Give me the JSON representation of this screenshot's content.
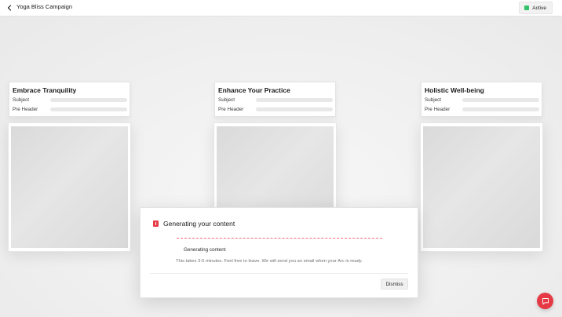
{
  "header": {
    "title": "Yoga Bliss Campaign",
    "status_label": "Active"
  },
  "cards": [
    {
      "title": "Embrace Tranquility",
      "subject_label": "Subject",
      "preheader_label": "Pre Header"
    },
    {
      "title": "Enhance Your Practice",
      "subject_label": "Subject",
      "preheader_label": "Pre Header"
    },
    {
      "title": "Holistic Well-being",
      "subject_label": "Subject",
      "preheader_label": "Pre Header"
    }
  ],
  "modal": {
    "title": "Generating your content",
    "status": "Generating content",
    "note": "This takes 3-5 minutes. Feel free to leave. We will send you an email when your Arc is ready.",
    "dismiss_label": "Dismiss"
  },
  "colors": {
    "accent": "#e63946",
    "status_active": "#34c26a"
  },
  "icons": {
    "back": "chevron-left-icon",
    "status": "status-dot-icon",
    "modal": "generating-icon",
    "chat": "chat-icon"
  }
}
